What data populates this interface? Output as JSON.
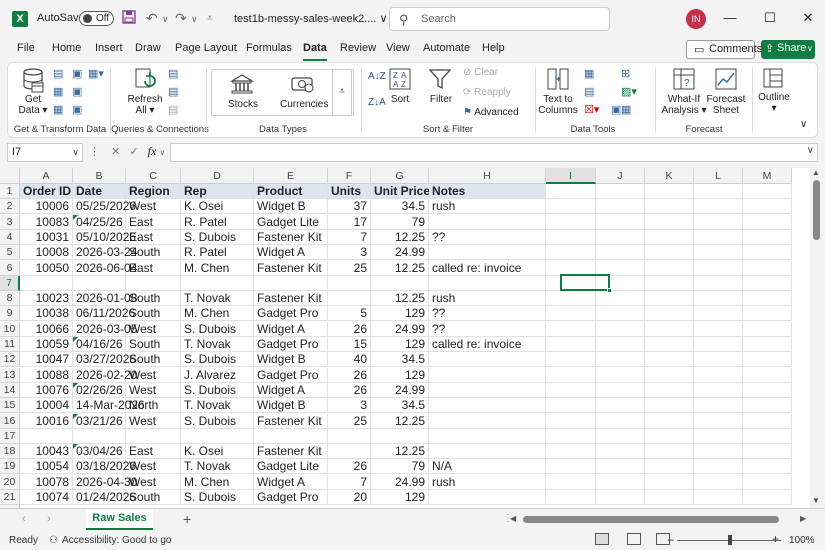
{
  "titlebar": {
    "app_icon": "excel-icon",
    "autosave_label": "AutoSave",
    "autosave_state": "Off",
    "filename": "test1b-messy-sales-week2....",
    "filename_chevron": "∨",
    "search_placeholder": "Search",
    "avatar_initials": "IN",
    "minimize": "—",
    "maximize": "☐",
    "close": "✕"
  },
  "menu": {
    "tabs": [
      "File",
      "Home",
      "Insert",
      "Draw",
      "Page Layout",
      "Formulas",
      "Data",
      "Review",
      "View",
      "Automate",
      "Help"
    ],
    "active_tab": "Data",
    "comments_label": "Comments",
    "share_label": "Share"
  },
  "ribbon": {
    "get_data": "Get Data ▾",
    "get_data_line1": "Get",
    "get_data_line2": "Data ▾",
    "refresh_line1": "Refresh",
    "refresh_line2": "All ▾",
    "stocks": "Stocks",
    "currencies": "Currencies",
    "sort": "Sort",
    "filter": "Filter",
    "clear": "Clear",
    "reapply": "Reapply",
    "advanced": "Advanced",
    "text_to_columns_line1": "Text to",
    "text_to_columns_line2": "Columns",
    "whatif_line1": "What-If",
    "whatif_line2": "Analysis ▾",
    "forecast_line1": "Forecast",
    "forecast_line2": "Sheet",
    "outline_line1": "Outline",
    "outline_line2": "▾",
    "groups": {
      "get_transform": "Get & Transform Data",
      "queries": "Queries & Connections",
      "data_types": "Data Types",
      "sort_filter": "Sort & Filter",
      "data_tools": "Data Tools",
      "forecast": "Forecast"
    }
  },
  "formula_bar": {
    "name_box": "I7",
    "fx": "fx",
    "value": ""
  },
  "grid": {
    "columns": [
      "A",
      "B",
      "C",
      "D",
      "E",
      "F",
      "G",
      "H",
      "I",
      "J",
      "K",
      "L",
      "M"
    ],
    "selected_column": "I",
    "selected_row": "7",
    "rows": [
      {
        "n": "1",
        "hdr": true,
        "cells": [
          "Order ID",
          "Date",
          "Region",
          "Rep",
          "Product",
          "Units",
          "Unit Price",
          "Notes"
        ]
      },
      {
        "n": "2",
        "cells": [
          "10006",
          "05/25/2026",
          "West",
          "K. Osei",
          "Widget B",
          "37",
          "34.5",
          "rush"
        ]
      },
      {
        "n": "3",
        "tri": true,
        "cells": [
          "10083",
          "04/25/26",
          "East",
          "R. Patel",
          "Gadget Lite",
          "17",
          "79",
          ""
        ]
      },
      {
        "n": "4",
        "cells": [
          "10031",
          "05/10/2026",
          "East",
          "S. Dubois",
          "Fastener Kit",
          "7",
          "12.25",
          "??"
        ]
      },
      {
        "n": "5",
        "cells": [
          "10008",
          "2026-03-24",
          "South",
          "R. Patel",
          "Widget A",
          "3",
          "24.99",
          ""
        ]
      },
      {
        "n": "6",
        "cells": [
          "10050",
          "2026-06-04",
          "East",
          "M. Chen",
          "Fastener Kit",
          "25",
          "12.25",
          "called re: invoice"
        ]
      },
      {
        "n": "7",
        "cells": [
          "",
          "",
          "",
          "",
          "",
          "",
          "",
          ""
        ]
      },
      {
        "n": "8",
        "cells": [
          "10023",
          "2026-01-08",
          "South",
          "T. Novak",
          "Fastener Kit",
          "",
          "12.25",
          "rush"
        ]
      },
      {
        "n": "9",
        "cells": [
          "10038",
          "06/11/2026",
          "South",
          "M. Chen",
          "Gadget Pro",
          "5",
          "129",
          "??"
        ]
      },
      {
        "n": "10",
        "cells": [
          "10066",
          "2026-03-05",
          "West",
          "S. Dubois",
          "Widget A",
          "26",
          "24.99",
          "??"
        ]
      },
      {
        "n": "11",
        "tri": true,
        "cells": [
          "10059",
          "04/16/26",
          "South",
          "T. Novak",
          "Gadget Pro",
          "15",
          "129",
          "called re: invoice"
        ]
      },
      {
        "n": "12",
        "cells": [
          "10047",
          "03/27/2026",
          "South",
          "S. Dubois",
          "Widget B",
          "40",
          "34.5",
          ""
        ]
      },
      {
        "n": "13",
        "cells": [
          "10088",
          "2026-02-20",
          "West",
          "J. Alvarez",
          "Gadget Pro",
          "26",
          "129",
          ""
        ]
      },
      {
        "n": "14",
        "tri": true,
        "cells": [
          "10076",
          "02/26/26",
          "West",
          "S. Dubois",
          "Widget A",
          "26",
          "24.99",
          ""
        ]
      },
      {
        "n": "15",
        "cells": [
          "10004",
          "14-Mar-2026",
          "North",
          "T. Novak",
          "Widget B",
          "3",
          "34.5",
          ""
        ]
      },
      {
        "n": "16",
        "tri": true,
        "cells": [
          "10016",
          "03/21/26",
          "West",
          "S. Dubois",
          "Fastener Kit",
          "25",
          "12.25",
          ""
        ]
      },
      {
        "n": "17",
        "cells": [
          "",
          "",
          "",
          "",
          "",
          "",
          "",
          ""
        ]
      },
      {
        "n": "18",
        "tri": true,
        "cells": [
          "10043",
          "03/04/26",
          "East",
          "K. Osei",
          "Fastener Kit",
          "",
          "12.25",
          ""
        ]
      },
      {
        "n": "19",
        "cells": [
          "10054",
          "03/18/2026",
          "West",
          "T. Novak",
          "Gadget Lite",
          "26",
          "79",
          "N/A"
        ]
      },
      {
        "n": "20",
        "cells": [
          "10078",
          "2026-04-30",
          "West",
          "M. Chen",
          "Widget A",
          "7",
          "24.99",
          "rush"
        ]
      },
      {
        "n": "21",
        "cells": [
          "10074",
          "01/24/2026",
          "South",
          "S. Dubois",
          "Gadget Pro",
          "20",
          "129",
          ""
        ]
      }
    ]
  },
  "sheets": {
    "active": "Raw Sales",
    "add": "+"
  },
  "status": {
    "ready": "Ready",
    "accessibility": "Accessibility: Good to go",
    "zoom": "100%"
  }
}
